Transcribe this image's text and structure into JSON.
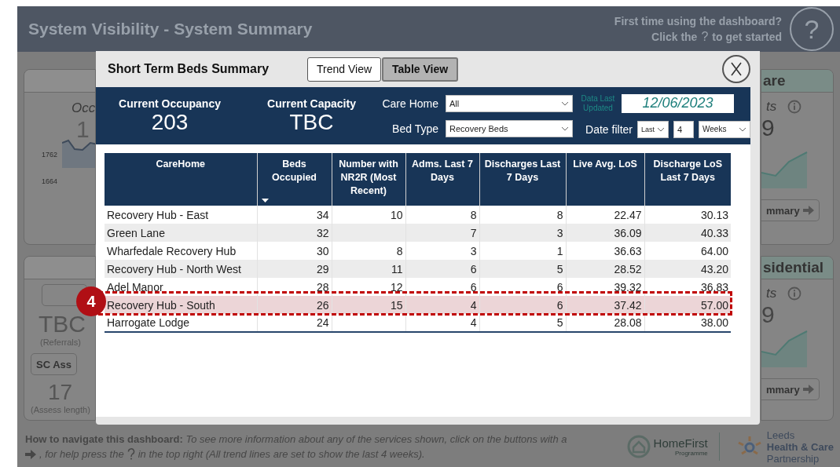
{
  "dashboard": {
    "title": "System Visibility - System Summary",
    "help_prompt": "First time using the dashboard?",
    "help_hint": [
      "Click the",
      "?",
      "to get started"
    ],
    "help_button": "?"
  },
  "left_cards": [
    {
      "kind": "trend",
      "metric_label": "Occ",
      "value": "1",
      "chart_labels": [
        "1762",
        "1664"
      ]
    },
    {
      "kind": "referrals",
      "value": "TBC",
      "caption": "(Referrals)",
      "button": "SC Ass",
      "value2": "17",
      "caption2": "(Assess length)"
    }
  ],
  "right_cards": [
    {
      "title": "are",
      "metric_label": "ts",
      "value": "9",
      "button": "mmary"
    },
    {
      "title": "sidential",
      "metric_label": "ts",
      "value": "9",
      "button": "mmary"
    }
  ],
  "footer": {
    "line1": "**How to navigate this dashboard:** *To see more information about any of the services shown, click on the buttons with a*",
    "line2_start": ", for help press the",
    "line2_end": "in the top right (All trend lines are set to show the last 4 weeks).",
    "logos": [
      {
        "kind": "homefirst",
        "name": "HomeFirst",
        "subtitle": "Programme"
      },
      {
        "kind": "leeds",
        "lines": [
          "Leeds",
          "Health & Care",
          "Partnership"
        ]
      }
    ]
  },
  "modal": {
    "title": "Short Term Beds Summary",
    "views": [
      {
        "label": "Trend View",
        "selected": false
      },
      {
        "label": "Table View",
        "selected": true
      }
    ],
    "kpis": [
      {
        "label": "Current Occupancy",
        "value": "203"
      },
      {
        "label": "Current Capacity",
        "value": "TBC"
      }
    ],
    "filters": [
      {
        "label": "Care Home",
        "value": "All"
      },
      {
        "label": "Bed Type",
        "value": "Recovery Beds"
      }
    ],
    "data_updated": {
      "label": "Data Last Updated",
      "value": "12/06/2023"
    },
    "date_filter": {
      "label": "Date filter",
      "period": "Last",
      "count": "4",
      "unit": "Weeks"
    },
    "table": {
      "columns": [
        {
          "label": "CareHome",
          "sorted": false
        },
        {
          "label": "Beds Occupied",
          "sorted": true
        },
        {
          "label": "Number with NR2R (Most Recent)",
          "sorted": false
        },
        {
          "label": "Adms. Last 7 Days",
          "sorted": false
        },
        {
          "label": "Discharges Last 7 Days",
          "sorted": false
        },
        {
          "label": "Live Avg. LoS",
          "sorted": false
        },
        {
          "label": "Discharge LoS Last 7 Days",
          "sorted": false
        }
      ],
      "rows": [
        {
          "cells": [
            "Recovery Hub - East",
            "34",
            "10",
            "8",
            "8",
            "22.47",
            "30.13"
          ],
          "highlighted": false
        },
        {
          "cells": [
            "Green Lane",
            "32",
            "",
            "7",
            "3",
            "36.09",
            "40.33"
          ],
          "highlighted": false
        },
        {
          "cells": [
            "Wharfedale Recovery Hub",
            "30",
            "8",
            "3",
            "1",
            "36.63",
            "64.00"
          ],
          "highlighted": false
        },
        {
          "cells": [
            "Recovery Hub - North West",
            "29",
            "11",
            "6",
            "5",
            "28.52",
            "43.20"
          ],
          "highlighted": false
        },
        {
          "cells": [
            "Adel Manor",
            "28",
            "12",
            "6",
            "6",
            "39.32",
            "36.83"
          ],
          "highlighted": false
        },
        {
          "cells": [
            "Recovery Hub - South",
            "26",
            "15",
            "4",
            "6",
            "37.42",
            "57.00"
          ],
          "highlighted": true
        },
        {
          "cells": [
            "Harrogate Lodge",
            "24",
            "",
            "4",
            "5",
            "28.08",
            "38.00"
          ],
          "highlighted": false
        }
      ]
    }
  },
  "annotation": {
    "step": "4"
  }
}
